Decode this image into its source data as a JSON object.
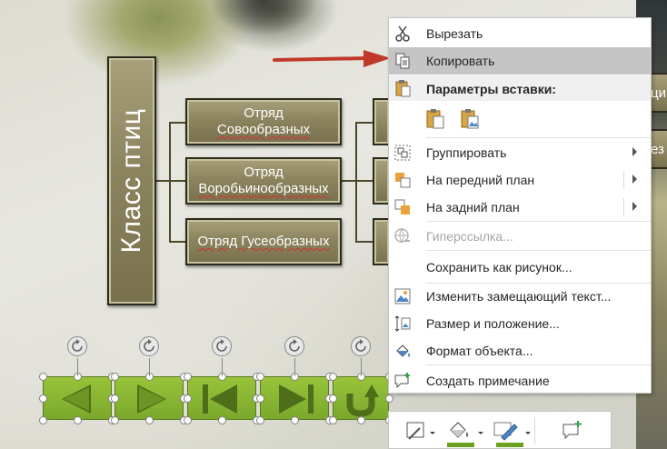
{
  "smartart": {
    "root": "Класс птиц",
    "children": [
      {
        "line1": "Отряд",
        "line2": "Совообразных"
      },
      {
        "line1": "Отряд",
        "line2": "Воробьинообразных"
      },
      {
        "line1": "Отряд Гусеобразных",
        "line2": ""
      }
    ],
    "peek_right": [
      "ци",
      "ез"
    ]
  },
  "nav_buttons": [
    {
      "icon": "previous-arrow-icon"
    },
    {
      "icon": "next-arrow-icon"
    },
    {
      "icon": "first-slide-icon"
    },
    {
      "icon": "last-slide-icon"
    },
    {
      "icon": "return-icon"
    }
  ],
  "context_menu": {
    "cut": "Вырезать",
    "copy": "Копировать",
    "paste_options": "Параметры вставки:",
    "group": "Группировать",
    "bring_forward": "На передний план",
    "send_backward": "На задний план",
    "hyperlink": "Гиперссылка...",
    "save_as_picture": "Сохранить как рисунок...",
    "edit_alt_text": "Изменить замещающий текст...",
    "size_position": "Размер и положение...",
    "format_object": "Формат объекта...",
    "new_comment": "Создать примечание"
  },
  "mini_toolbar": {
    "fill_color": "#6aa121",
    "outline_color": "#6aa121"
  },
  "colors": {
    "accent_green": "#8ab832",
    "smartart_fill": "#8c845f",
    "arrow_red": "#c0392b",
    "menu_highlight": "#c5c5c5"
  }
}
